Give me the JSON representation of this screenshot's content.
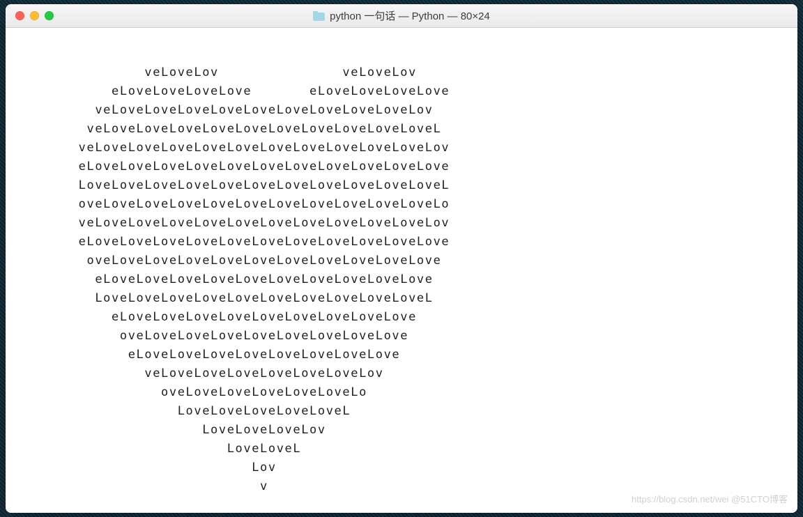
{
  "window": {
    "title": "python 一句话 — Python — 80×24"
  },
  "terminal": {
    "lines": [
      "                veLoveLov               veLoveLov",
      "            eLoveLoveLoveLove       eLoveLoveLoveLove",
      "          veLoveLoveLoveLoveLoveLoveLoveLoveLoveLov",
      "         veLoveLoveLoveLoveLoveLoveLoveLoveLoveLoveL",
      "        veLoveLoveLoveLoveLoveLoveLoveLoveLoveLoveLov",
      "        eLoveLoveLoveLoveLoveLoveLoveLoveLoveLoveLove",
      "        LoveLoveLoveLoveLoveLoveLoveLoveLoveLoveLoveL",
      "        oveLoveLoveLoveLoveLoveLoveLoveLoveLoveLoveLo",
      "        veLoveLoveLoveLoveLoveLoveLoveLoveLoveLoveLov",
      "        eLoveLoveLoveLoveLoveLoveLoveLoveLoveLoveLove",
      "         oveLoveLoveLoveLoveLoveLoveLoveLoveLoveLove",
      "          eLoveLoveLoveLoveLoveLoveLoveLoveLoveLove",
      "          LoveLoveLoveLoveLoveLoveLoveLoveLoveLoveL",
      "            eLoveLoveLoveLoveLoveLoveLoveLoveLove",
      "             oveLoveLoveLoveLoveLoveLoveLoveLove",
      "              eLoveLoveLoveLoveLoveLoveLoveLove",
      "                veLoveLoveLoveLoveLoveLoveLov",
      "                  oveLoveLoveLoveLoveLoveLo",
      "                    LoveLoveLoveLoveLoveL",
      "                       LoveLoveLoveLov",
      "                          LoveLoveL",
      "                             Lov",
      "                              v"
    ]
  },
  "watermark": {
    "text": "https://blog.csdn.net/wei @51CTO博客"
  }
}
